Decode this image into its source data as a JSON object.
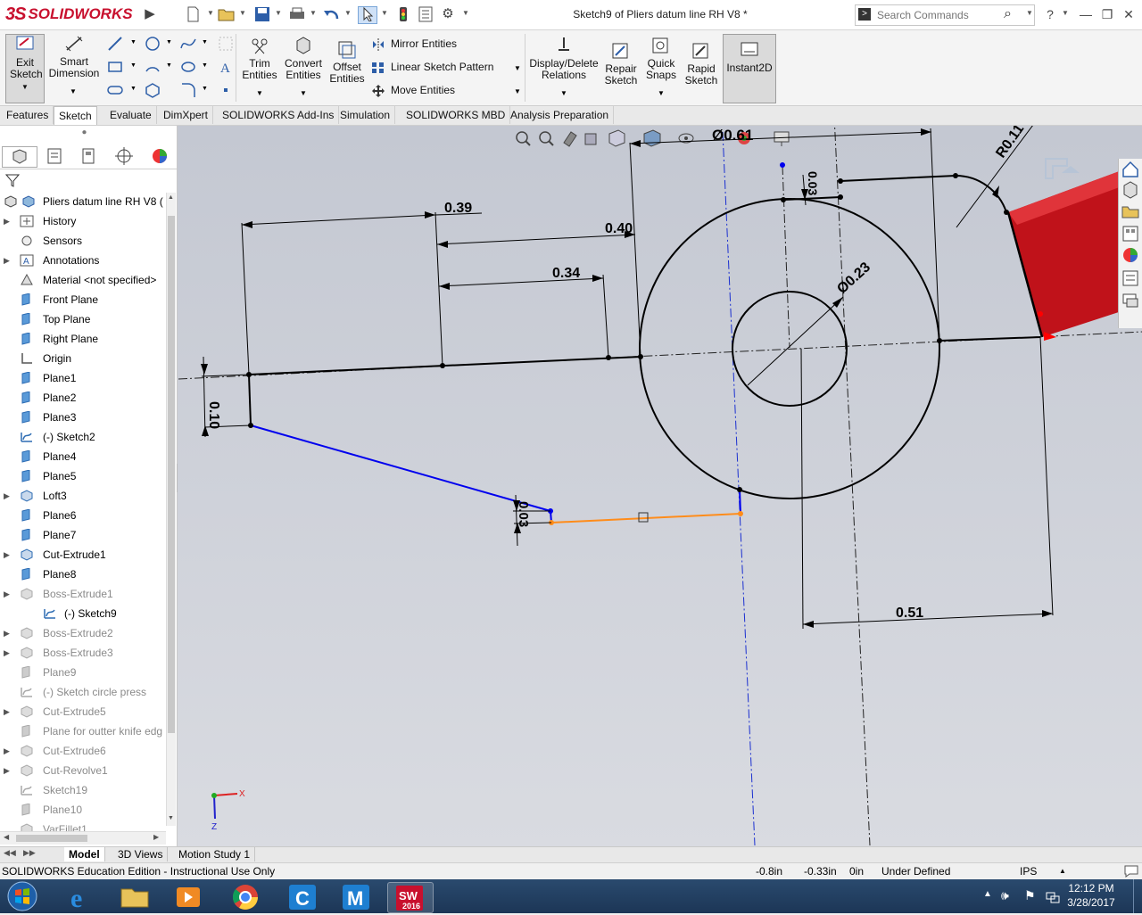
{
  "app": {
    "logo_ds": "3S",
    "logo_text": "SOLIDWORKS",
    "document_title": "Sketch9 of Pliers datum line RH V8 *"
  },
  "search": {
    "placeholder": "Search Commands"
  },
  "ribbon": {
    "exit_sketch": "Exit Sketch",
    "smart_dimension": "Smart Dimension",
    "trim_entities": "Trim Entities",
    "convert_entities": "Convert Entities",
    "offset_entities": "Offset Entities",
    "mirror_entities": "Mirror Entities",
    "linear_sketch_pattern": "Linear Sketch Pattern",
    "move_entities": "Move Entities",
    "display_delete_relations": "Display/Delete Relations",
    "repair_sketch": "Repair Sketch",
    "quick_snaps": "Quick Snaps",
    "rapid_sketch": "Rapid Sketch",
    "instant2d": "Instant2D"
  },
  "tabs": [
    "Features",
    "Sketch",
    "Evaluate",
    "DimXpert",
    "SOLIDWORKS Add-Ins",
    "Simulation",
    "SOLIDWORKS MBD",
    "Analysis Preparation"
  ],
  "tree": {
    "root": "Pliers datum line RH V8  (",
    "items": [
      {
        "label": "History",
        "gray": false
      },
      {
        "label": "Sensors",
        "gray": false
      },
      {
        "label": "Annotations",
        "gray": false
      },
      {
        "label": "Material <not specified>",
        "gray": false
      },
      {
        "label": "Front Plane",
        "gray": false
      },
      {
        "label": "Top Plane",
        "gray": false
      },
      {
        "label": "Right Plane",
        "gray": false
      },
      {
        "label": "Origin",
        "gray": false
      },
      {
        "label": "Plane1",
        "gray": false
      },
      {
        "label": "Plane2",
        "gray": false
      },
      {
        "label": "Plane3",
        "gray": false
      },
      {
        "label": "(-) Sketch2",
        "gray": false
      },
      {
        "label": "Plane4",
        "gray": false
      },
      {
        "label": "Plane5",
        "gray": false
      },
      {
        "label": "Loft3",
        "gray": false
      },
      {
        "label": "Plane6",
        "gray": false
      },
      {
        "label": "Plane7",
        "gray": false
      },
      {
        "label": "Cut-Extrude1",
        "gray": false
      },
      {
        "label": "Plane8",
        "gray": false
      },
      {
        "label": "Boss-Extrude1",
        "gray": true
      },
      {
        "label": "(-) Sketch9",
        "gray": false
      },
      {
        "label": "Boss-Extrude2",
        "gray": true
      },
      {
        "label": "Boss-Extrude3",
        "gray": true
      },
      {
        "label": "Plane9",
        "gray": true
      },
      {
        "label": "(-) Sketch circle press",
        "gray": true
      },
      {
        "label": "Cut-Extrude5",
        "gray": true
      },
      {
        "label": "Plane for outter knife edg",
        "gray": true
      },
      {
        "label": "Cut-Extrude6",
        "gray": true
      },
      {
        "label": "Cut-Revolve1",
        "gray": true
      },
      {
        "label": "Sketch19",
        "gray": true
      },
      {
        "label": "Plane10",
        "gray": true
      },
      {
        "label": "VarFillet1",
        "gray": true
      }
    ]
  },
  "dimensions": {
    "d1": "0.39",
    "d2": "0.40",
    "d3": "0.34",
    "d4": "0.10",
    "d5": "0.03",
    "d6": "0.51",
    "d7": "Ø0.61",
    "d8": "Ø0.23",
    "d9": "R0.11",
    "d10": "0.03"
  },
  "bottom_tabs": [
    "Model",
    "3D Views",
    "Motion Study 1"
  ],
  "status": {
    "edition": "SOLIDWORKS Education Edition - Instructional Use Only",
    "x": "-0.8in",
    "y": "-0.33in",
    "z": "0in",
    "state": "Under Defined",
    "units": "IPS"
  },
  "taskbar": {
    "time": "12:12 PM",
    "date": "3/28/2017",
    "sw_badge": "SW",
    "sw_year": "2016",
    "c_label": "C",
    "m_label": "M"
  },
  "triad": {
    "x": "X",
    "z": "Z"
  },
  "colors": {
    "sketch_blue": "#0000ee",
    "sketch_orange": "#ff8c1a",
    "part_red": "#c0121a",
    "brand_red": "#c8102e"
  }
}
